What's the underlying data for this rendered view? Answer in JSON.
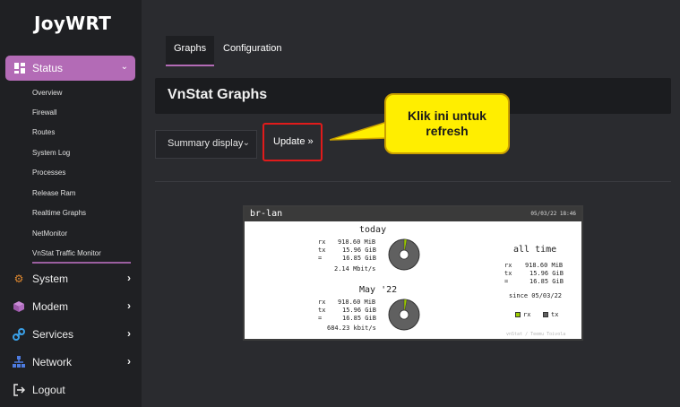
{
  "app": {
    "logo": "JoyWRT"
  },
  "sidebar": {
    "active": {
      "label": "Status"
    },
    "subitems": [
      "Overview",
      "Firewall",
      "Routes",
      "System Log",
      "Processes",
      "Release Ram",
      "Realtime Graphs",
      "NetMonitor",
      "VnStat Traffic Monitor"
    ],
    "menus": [
      {
        "label": "System",
        "has_children": true
      },
      {
        "label": "Modem",
        "has_children": true
      },
      {
        "label": "Services",
        "has_children": true
      },
      {
        "label": "Network",
        "has_children": true
      },
      {
        "label": "Logout",
        "has_children": false
      }
    ]
  },
  "tabs": [
    {
      "label": "Graphs",
      "active": true
    },
    {
      "label": "Configuration",
      "active": false
    }
  ],
  "section": {
    "title": "VnStat Graphs"
  },
  "controls": {
    "display_select": "Summary display",
    "update_button": "Update »"
  },
  "callout": {
    "line1": "Klik ini untuk",
    "line2": "refresh"
  },
  "vnstat": {
    "interface": "br-lan",
    "datetime": "05/03/22 18:46",
    "today": {
      "title": "today",
      "rx": "918.60 MiB",
      "tx": "15.96 GiB",
      "total": "16.85 GiB",
      "rate": "2.14 Mbit/s"
    },
    "month": {
      "title": "May '22",
      "rx": "918.60 MiB",
      "tx": "15.96 GiB",
      "total": "16.85 GiB",
      "rate": "684.23 kbit/s"
    },
    "alltime": {
      "title": "all time",
      "rx": "918.60 MiB",
      "tx": "15.96 GiB",
      "total": "16.85 GiB",
      "since": "since 05/03/22"
    },
    "legend": {
      "rx": "rx",
      "tx": "tx"
    },
    "credit": "vnStat / Teemu Toivola",
    "colors": {
      "rx": "#9ccc00",
      "tx": "#606060"
    }
  },
  "colors": {
    "accent": "#b36bb6",
    "callout": "#ffee00",
    "highlight": "#e01b1b"
  }
}
